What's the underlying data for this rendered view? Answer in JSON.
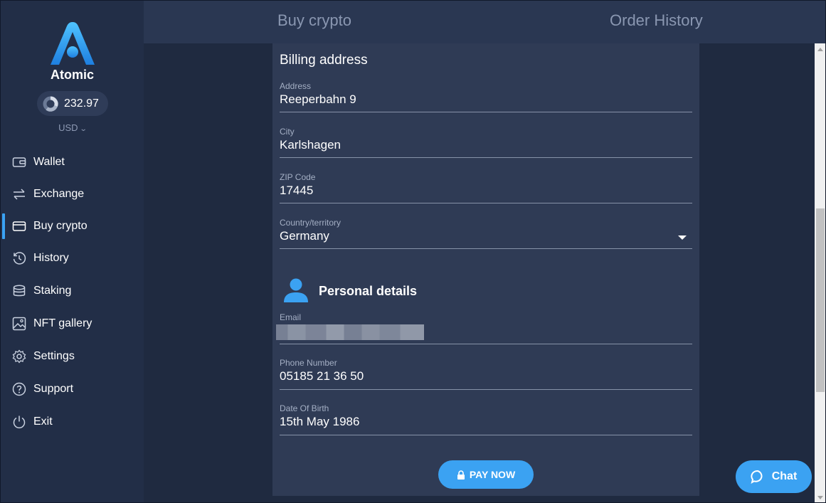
{
  "brand": {
    "name": "Atomic"
  },
  "balance": {
    "value": "232.97",
    "currency": "USD"
  },
  "sidebar": {
    "items": [
      {
        "label": "Wallet",
        "icon": "wallet-icon"
      },
      {
        "label": "Exchange",
        "icon": "exchange-icon"
      },
      {
        "label": "Buy crypto",
        "icon": "card-icon",
        "active": true
      },
      {
        "label": "History",
        "icon": "history-icon"
      },
      {
        "label": "Staking",
        "icon": "staking-icon"
      },
      {
        "label": "NFT gallery",
        "icon": "image-icon"
      },
      {
        "label": "Settings",
        "icon": "gear-icon"
      },
      {
        "label": "Support",
        "icon": "help-icon"
      },
      {
        "label": "Exit",
        "icon": "power-icon"
      }
    ]
  },
  "tabs": {
    "buy": "Buy crypto",
    "history": "Order History"
  },
  "billing": {
    "title": "Billing address",
    "address": {
      "label": "Address",
      "value": "Reeperbahn 9"
    },
    "city": {
      "label": "City",
      "value": "Karlshagen"
    },
    "zip": {
      "label": "ZIP Code",
      "value": "17445"
    },
    "country": {
      "label": "Country/territory",
      "value": "Germany"
    }
  },
  "personal": {
    "title": "Personal details",
    "email": {
      "label": "Email"
    },
    "phone": {
      "label": "Phone Number",
      "value": "05185 21 36 50"
    },
    "dob": {
      "label": "Date Of Birth",
      "value": "15th May 1986"
    }
  },
  "actions": {
    "pay": "PAY NOW",
    "chat": "Chat"
  },
  "colors": {
    "accent": "#3ba2f2",
    "sidebar": "#222e47",
    "panel": "#2f3b55"
  }
}
